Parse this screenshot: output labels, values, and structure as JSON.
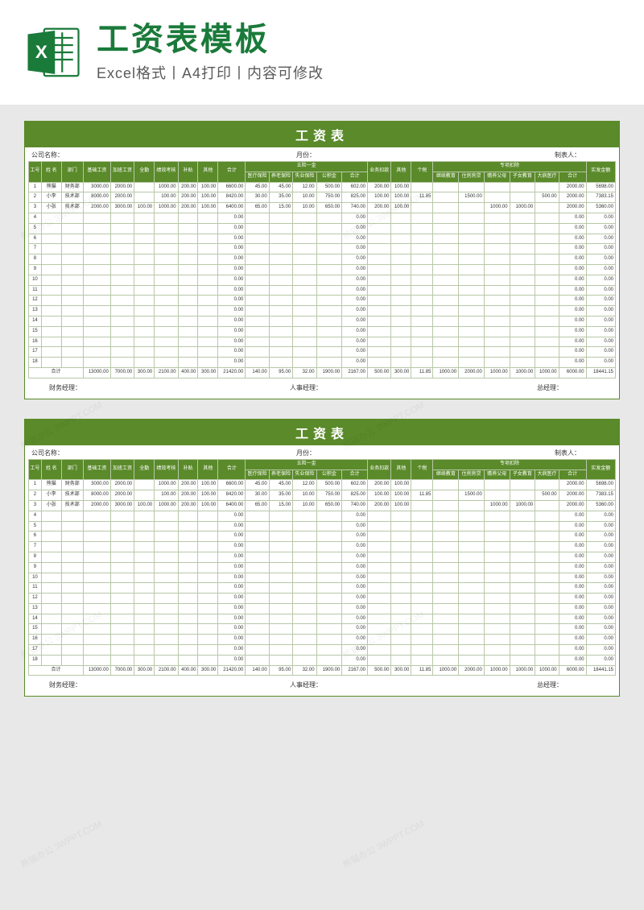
{
  "header": {
    "title": "工资表模板",
    "subtitle": "Excel格式丨A4打印丨内容可修改"
  },
  "watermark": "熊猫办公 3WPPT.COM",
  "sheet": {
    "title": "工资表",
    "meta": {
      "company": "公司名称：",
      "month": "月份：",
      "maker": "制表人："
    },
    "signs": {
      "finance": "财务经理：",
      "hr": "人事经理：",
      "gm": "总经理："
    },
    "headers_group": {
      "wuxian": "五险一金",
      "zhuanxiang": "专项扣除"
    },
    "headers": {
      "id": "工号",
      "name": "姓 名",
      "dept": "部门",
      "base": "基础工资",
      "ot": "加班工资",
      "full": "全勤",
      "perf": "绩效考核",
      "allow": "补贴",
      "other": "其他",
      "sum1": "合计",
      "med": "医疗保险",
      "pen": "养老保险",
      "unemp": "失业保险",
      "fund": "公积金",
      "sum2": "合计",
      "biz": "业务扣款",
      "other2": "其他",
      "tax": "个税",
      "edu": "继续教育",
      "house": "住房房贷",
      "elder": "赡养父母",
      "child": "子女教育",
      "sick": "大病医疗",
      "sum3": "合计",
      "net": "实发金额"
    },
    "rows": [
      {
        "id": "1",
        "name": "熊猫",
        "dept": "财务部",
        "base": "3000.00",
        "ot": "2000.00",
        "full": "",
        "perf": "1000.00",
        "allow": "200.00",
        "other": "100.00",
        "sum1": "6600.00",
        "med": "45.00",
        "pen": "45.00",
        "unemp": "12.00",
        "fund": "500.00",
        "sum2": "602.00",
        "biz": "200.00",
        "other2": "100.00",
        "tax": "",
        "edu": "",
        "house": "",
        "elder": "",
        "child": "",
        "sick": "",
        "sum3": "2000.00",
        "net": "5698.00"
      },
      {
        "id": "2",
        "name": "小李",
        "dept": "技术部",
        "base": "8000.00",
        "ot": "2000.00",
        "full": "",
        "perf": "100.00",
        "allow": "200.00",
        "other": "100.00",
        "sum1": "8420.00",
        "med": "30.00",
        "pen": "35.00",
        "unemp": "10.00",
        "fund": "750.00",
        "sum2": "825.00",
        "biz": "100.00",
        "other2": "100.00",
        "tax": "11.85",
        "edu": "",
        "house": "1500.00",
        "elder": "",
        "child": "",
        "sick": "500.00",
        "sum3": "2000.00",
        "net": "7383.15"
      },
      {
        "id": "3",
        "name": "小张",
        "dept": "技术部",
        "base": "2000.00",
        "ot": "3000.00",
        "full": "100.00",
        "perf": "1000.00",
        "allow": "200.00",
        "other": "100.00",
        "sum1": "6400.00",
        "med": "65.00",
        "pen": "15.00",
        "unemp": "10.00",
        "fund": "650.00",
        "sum2": "740.00",
        "biz": "200.00",
        "other2": "100.00",
        "tax": "",
        "edu": "",
        "house": "",
        "elder": "1000.00",
        "child": "1000.00",
        "sick": "",
        "sum3": "2000.00",
        "net": "5360.00"
      },
      {
        "id": "4",
        "sum1": "0.00",
        "sum2": "0.00",
        "tax": "",
        "sum3": "0.00",
        "net": "0.00"
      },
      {
        "id": "5",
        "sum1": "0.00",
        "sum2": "0.00",
        "tax": "",
        "sum3": "0.00",
        "net": "0.00"
      },
      {
        "id": "6",
        "sum1": "0.00",
        "sum2": "0.00",
        "tax": "",
        "sum3": "0.00",
        "net": "0.00"
      },
      {
        "id": "7",
        "sum1": "0.00",
        "sum2": "0.00",
        "tax": "",
        "sum3": "0.00",
        "net": "0.00"
      },
      {
        "id": "8",
        "sum1": "0.00",
        "sum2": "0.00",
        "tax": "",
        "sum3": "0.00",
        "net": "0.00"
      },
      {
        "id": "9",
        "sum1": "0.00",
        "sum2": "0.00",
        "tax": "",
        "sum3": "0.00",
        "net": "0.00"
      },
      {
        "id": "10",
        "sum1": "0.00",
        "sum2": "0.00",
        "tax": "",
        "sum3": "0.00",
        "net": "0.00"
      },
      {
        "id": "11",
        "sum1": "0.00",
        "sum2": "0.00",
        "tax": "",
        "sum3": "0.00",
        "net": "0.00"
      },
      {
        "id": "12",
        "sum1": "0.00",
        "sum2": "0.00",
        "tax": "",
        "sum3": "0.00",
        "net": "0.00"
      },
      {
        "id": "13",
        "sum1": "0.00",
        "sum2": "0.00",
        "tax": "",
        "sum3": "0.00",
        "net": "0.00"
      },
      {
        "id": "14",
        "sum1": "0.00",
        "sum2": "0.00",
        "tax": "",
        "sum3": "0.00",
        "net": "0.00"
      },
      {
        "id": "15",
        "sum1": "0.00",
        "sum2": "0.00",
        "tax": "",
        "sum3": "0.00",
        "net": "0.00"
      },
      {
        "id": "16",
        "sum1": "0.00",
        "sum2": "0.00",
        "tax": "",
        "sum3": "0.00",
        "net": "0.00"
      },
      {
        "id": "17",
        "sum1": "0.00",
        "sum2": "0.00",
        "tax": "",
        "sum3": "0.00",
        "net": "0.00"
      },
      {
        "id": "18",
        "sum1": "0.00",
        "sum2": "0.00",
        "tax": "",
        "sum3": "0.00",
        "net": "0.00"
      }
    ],
    "total_label": "合计",
    "total": {
      "base": "13000.00",
      "ot": "7000.00",
      "full": "300.00",
      "perf": "2100.00",
      "allow": "400.00",
      "other": "300.00",
      "sum1": "21420.00",
      "med": "140.00",
      "pen": "95.00",
      "unemp": "32.00",
      "fund": "1900.00",
      "sum2": "2167.00",
      "biz": "500.00",
      "other2": "300.00",
      "tax": "11.85",
      "edu": "1000.00",
      "house": "2000.00",
      "elder": "1000.00",
      "child": "1000.00",
      "sick": "1000.00",
      "sum3": "6000.00",
      "net": "18441.15"
    }
  }
}
